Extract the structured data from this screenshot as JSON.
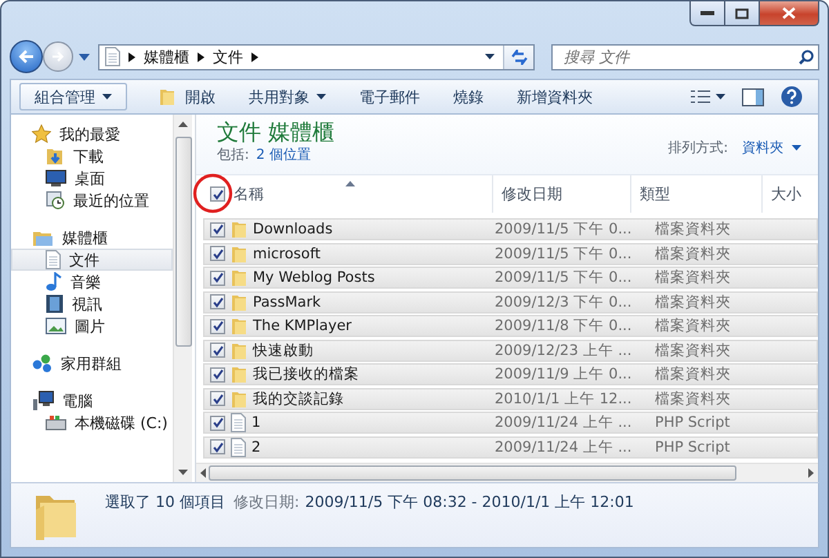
{
  "address": {
    "path": [
      "媒體櫃",
      "文件"
    ]
  },
  "search": {
    "placeholder": "搜尋 文件"
  },
  "toolbar": [
    {
      "label": "組合管理",
      "kind": "dropdown"
    },
    {
      "label": "開啟",
      "kind": "open"
    },
    {
      "label": "共用對象",
      "kind": "dropdown"
    },
    {
      "label": "電子郵件",
      "kind": "plain"
    },
    {
      "label": "燒錄",
      "kind": "plain"
    },
    {
      "label": "新增資料夾",
      "kind": "plain"
    }
  ],
  "sidebar": {
    "items": [
      {
        "label": "我的最愛",
        "kind": "favorites",
        "selected": false,
        "children": [
          {
            "label": "下載",
            "kind": "downloads",
            "selected": false
          },
          {
            "label": "桌面",
            "kind": "desktop",
            "selected": false
          },
          {
            "label": "最近的位置",
            "kind": "recent",
            "selected": false
          }
        ]
      },
      {
        "label": "媒體櫃",
        "kind": "library",
        "selected": false,
        "children": [
          {
            "label": "文件",
            "kind": "document",
            "selected": true
          },
          {
            "label": "音樂",
            "kind": "music",
            "selected": false
          },
          {
            "label": "視訊",
            "kind": "video",
            "selected": false
          },
          {
            "label": "圖片",
            "kind": "pictures",
            "selected": false
          }
        ]
      },
      {
        "label": "家用群組",
        "kind": "homegroup",
        "selected": false
      },
      {
        "label": "電腦",
        "kind": "computer",
        "selected": false,
        "children": [
          {
            "label": "本機磁碟 (C:)",
            "kind": "drive",
            "selected": false
          }
        ]
      }
    ]
  },
  "library": {
    "title": "文件 媒體櫃",
    "includes_label": "包括:",
    "includes_link": "2 個位置",
    "arrange_label": "排列方式:",
    "arrange_value": "資料夾"
  },
  "table": {
    "select_all_checked": true,
    "columns": [
      "名稱",
      "修改日期",
      "類型",
      "大小"
    ],
    "rows": [
      {
        "name": "Downloads",
        "modified": "2009/11/5 下午 0...",
        "type": "檔案資料夾",
        "kind": "folder",
        "checked": true,
        "selected": true
      },
      {
        "name": "microsoft",
        "modified": "2009/11/5 下午 0...",
        "type": "檔案資料夾",
        "kind": "folder",
        "checked": true,
        "selected": true
      },
      {
        "name": "My Weblog Posts",
        "modified": "2009/11/5 下午 0...",
        "type": "檔案資料夾",
        "kind": "folder",
        "checked": true,
        "selected": true
      },
      {
        "name": "PassMark",
        "modified": "2009/12/3 下午 0...",
        "type": "檔案資料夾",
        "kind": "folder",
        "checked": true,
        "selected": true
      },
      {
        "name": "The KMPlayer",
        "modified": "2009/11/8 下午 0...",
        "type": "檔案資料夾",
        "kind": "folder",
        "checked": true,
        "selected": true
      },
      {
        "name": "快速啟動",
        "modified": "2009/12/23 上午 ...",
        "type": "檔案資料夾",
        "kind": "folder",
        "checked": true,
        "selected": true
      },
      {
        "name": "我已接收的檔案",
        "modified": "2009/11/9 上午 0...",
        "type": "檔案資料夾",
        "kind": "folder",
        "checked": true,
        "selected": true
      },
      {
        "name": "我的交談記錄",
        "modified": "2010/1/1 上午 12...",
        "type": "檔案資料夾",
        "kind": "folder",
        "checked": true,
        "selected": true
      },
      {
        "name": "1",
        "modified": "2009/11/24 上午 ...",
        "type": "PHP Script",
        "kind": "file",
        "checked": true,
        "selected": true
      },
      {
        "name": "2",
        "modified": "2009/11/24 上午 ...",
        "type": "PHP Script",
        "kind": "file",
        "checked": true,
        "selected": true
      }
    ]
  },
  "status_bar": {
    "selection": "選取了 10 個項目",
    "modified_label": "修改日期:",
    "modified_value": "2009/11/5 下午 08:32 - 2010/1/1 上午 12:01"
  }
}
